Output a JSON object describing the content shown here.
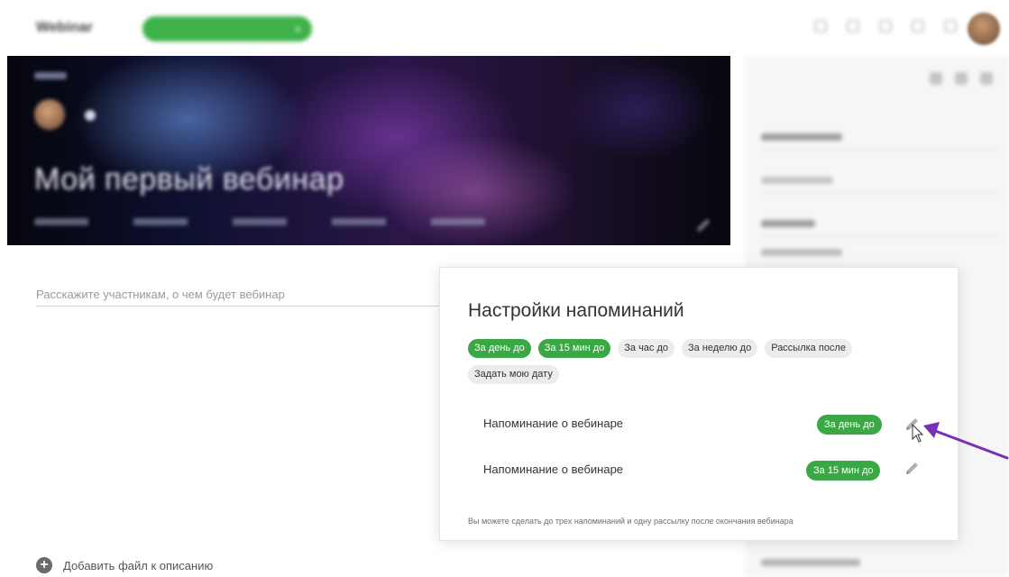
{
  "topbar": {
    "logo": "Webinar",
    "primary_button": "",
    "primary_plus": "+",
    "link": ""
  },
  "banner": {
    "title": "Мой первый вебинар"
  },
  "description": {
    "placeholder": "Расскажите участникам, о чем будет вебинар"
  },
  "attach": {
    "label": "Добавить файл к описанию"
  },
  "popup": {
    "title": "Настройки напоминаний",
    "chips": [
      {
        "label": "За день до",
        "active": true
      },
      {
        "label": "За 15 мин до",
        "active": true
      },
      {
        "label": "За час до",
        "active": false
      },
      {
        "label": "За неделю до",
        "active": false
      },
      {
        "label": "Рассылка после",
        "active": false
      },
      {
        "label": "Задать мою дату",
        "active": false
      }
    ],
    "reminders": [
      {
        "label": "Напоминание о вебинаре",
        "badge": "За день до"
      },
      {
        "label": "Напоминание о вебинаре",
        "badge": "За 15 мин до"
      }
    ],
    "note": "Вы можете сделать до трех напоминаний и одну рассылку после окончания вебинара"
  },
  "colors": {
    "accent": "#3aa845",
    "annotation_arrow": "#7a2fb8"
  },
  "icons": {
    "edit": "pencil-icon",
    "add": "plus-circle-icon",
    "cursor": "mouse-pointer-icon",
    "annotation": "arrow-annotation"
  }
}
